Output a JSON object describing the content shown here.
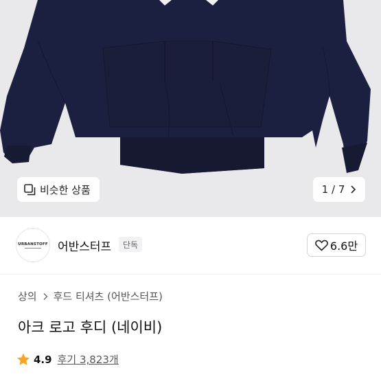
{
  "gallery": {
    "similar_label": "비슷한 상품",
    "page_current": "1",
    "page_sep": "/",
    "page_total": "7",
    "image_bg": "#e9e9eb",
    "product_color": "#1b1f3a"
  },
  "brand": {
    "logo_text": "URBANSTOFF",
    "name": "어반스터프",
    "badge": "단독",
    "like_count": "6.6만"
  },
  "breadcrumb": {
    "items": [
      "상의",
      "후드 티셔츠 (어반스터프)"
    ]
  },
  "product": {
    "title": "아크 로고 후디 (네이비)",
    "rating": "4.9",
    "review_label": "후기",
    "review_count": "3,823개",
    "star_color": "#f6a623"
  }
}
